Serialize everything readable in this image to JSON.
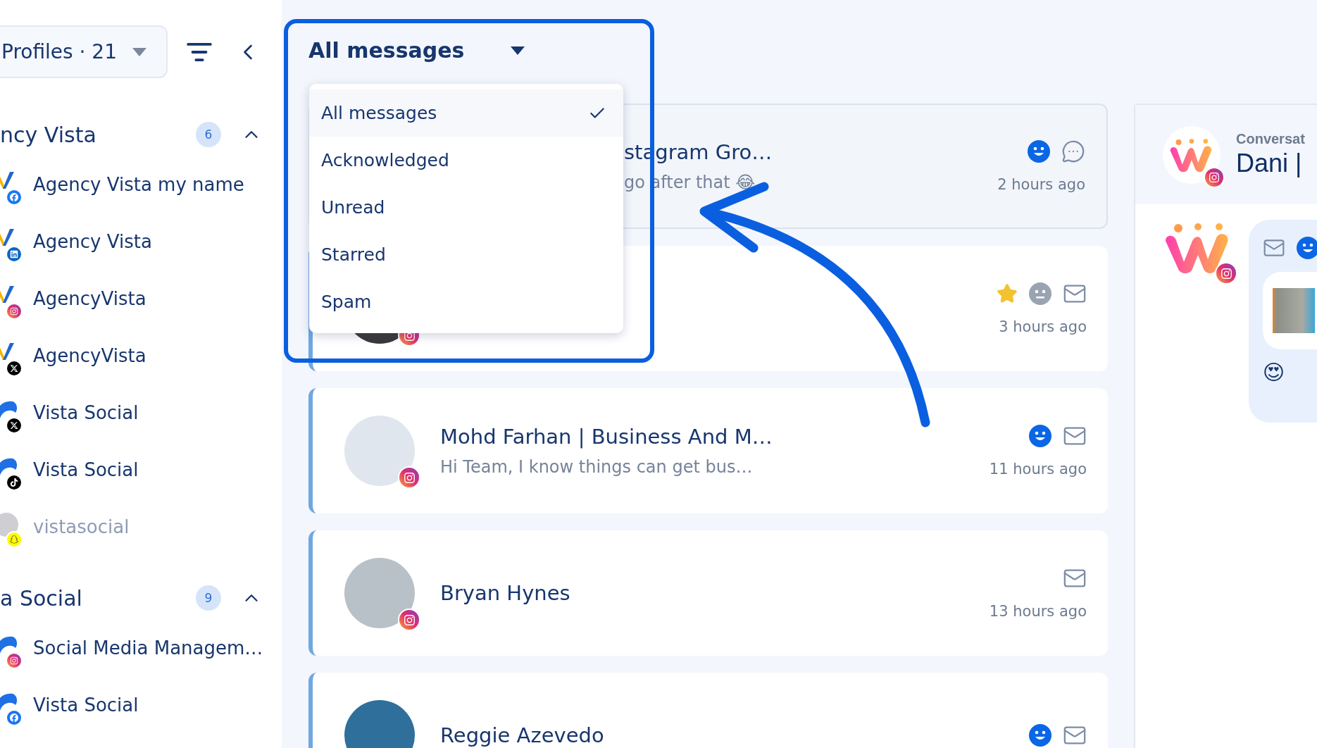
{
  "sidebar": {
    "profiles_button": "Profiles · 21",
    "groups": [
      {
        "title": "ncy Vista",
        "count": "6",
        "expanded": true,
        "items": [
          {
            "name": "Agency Vista my name",
            "disabled": false
          },
          {
            "name": "Agency Vista",
            "disabled": false
          },
          {
            "name": "AgencyVista",
            "disabled": false
          },
          {
            "name": "AgencyVista",
            "disabled": false
          },
          {
            "name": "Vista Social",
            "disabled": false
          },
          {
            "name": "Vista Social",
            "disabled": false
          },
          {
            "name": "vistasocial",
            "disabled": true
          }
        ]
      },
      {
        "title": "a Social",
        "count": "9",
        "expanded": true,
        "items": [
          {
            "name": "Social Media Managem…",
            "disabled": false
          },
          {
            "name": "Vista Social",
            "disabled": false
          }
        ]
      }
    ]
  },
  "filter": {
    "label": "All messages",
    "options": [
      {
        "label": "All messages",
        "selected": true
      },
      {
        "label": "Acknowledged",
        "selected": false
      },
      {
        "label": "Unread",
        "selected": false
      },
      {
        "label": "Starred",
        "selected": false
      },
      {
        "label": "Spam",
        "selected": false
      }
    ]
  },
  "messages": [
    {
      "title": "stagram Gro…",
      "preview": "go after that 😂",
      "time": "2 hours ago",
      "selected": true,
      "starred": false
    },
    {
      "time": "3 hours ago",
      "selected": false,
      "starred": true
    },
    {
      "title": "Mohd Farhan | Business And M…",
      "preview": "Hi Team, I know things can get bus…",
      "time": "11 hours ago",
      "selected": false,
      "starred": false
    },
    {
      "title": "Bryan Hynes",
      "time": "13 hours ago",
      "selected": false,
      "starred": false
    },
    {
      "title": "Reggie Azevedo",
      "selected": false,
      "starred": false
    }
  ],
  "conversation": {
    "label": "Conversat",
    "name": "Dani |",
    "message": {
      "emoji": "😍"
    }
  }
}
